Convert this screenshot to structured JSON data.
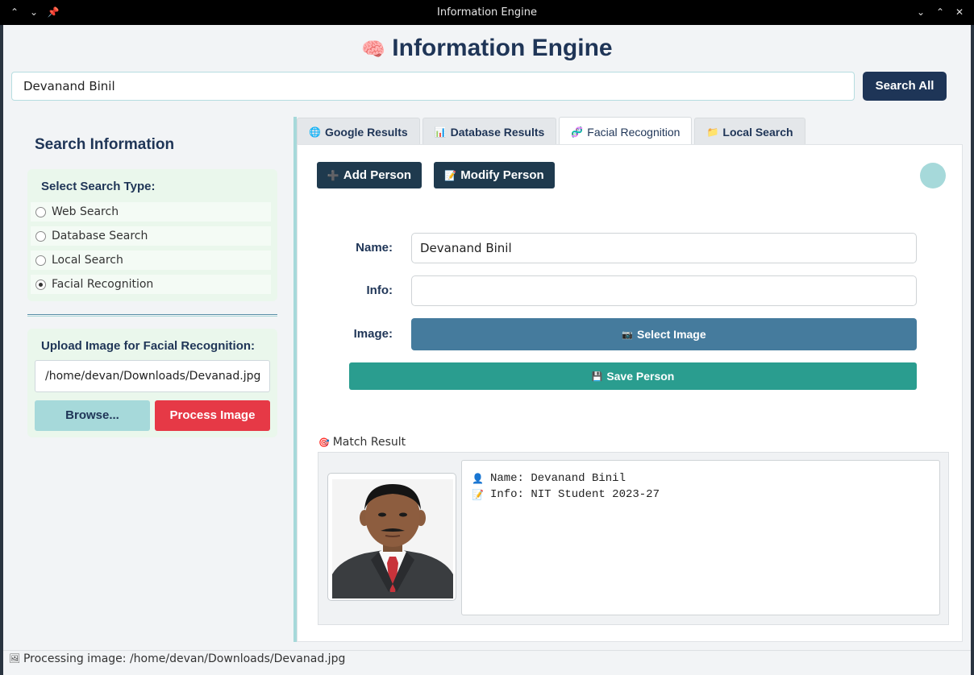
{
  "window": {
    "title": "Information Engine",
    "left_controls": [
      "⌃",
      "⌄",
      "📌"
    ],
    "right_controls": [
      "⌄",
      "⌃",
      "✕"
    ]
  },
  "header": {
    "icon": "🧠",
    "title": "Information Engine"
  },
  "search": {
    "value": "Devanand Binil",
    "button_label": "Search All"
  },
  "sidebar": {
    "title": "Search Information",
    "search_type_title": "Select Search Type:",
    "options": [
      {
        "label": "Web Search",
        "selected": false
      },
      {
        "label": "Database Search",
        "selected": false
      },
      {
        "label": "Local Search",
        "selected": false
      },
      {
        "label": "Facial Recognition",
        "selected": true
      }
    ],
    "upload_title": "Upload Image for Facial Recognition:",
    "upload_path": "/home/devan/Downloads/Devanad.jpg",
    "browse_label": "Browse...",
    "process_label": "Process Image"
  },
  "tabs": [
    {
      "icon": "🌐",
      "label": "Google Results",
      "active": false
    },
    {
      "icon": "📊",
      "label": "Database Results",
      "active": false
    },
    {
      "icon": "🧬",
      "label": "Facial Recognition",
      "active": true
    },
    {
      "icon": "📁",
      "label": "Local Search",
      "active": false
    }
  ],
  "facial": {
    "add_icon": "➕",
    "add_label": "Add Person",
    "modify_icon": "📝",
    "modify_label": "Modify Person",
    "name_label": "Name:",
    "name_value": "Devanand Binil",
    "info_label": "Info:",
    "info_value": "",
    "image_label": "Image:",
    "select_icon": "📷",
    "select_label": "Select Image",
    "save_icon": "💾",
    "save_label": "Save Person",
    "match_icon": "🎯",
    "match_label": "Match Result",
    "result": {
      "name_icon": "👤",
      "name_line": "Name: Devanand Binil",
      "info_icon": "📝",
      "info_line": "Info: NIT Student 2023-27"
    }
  },
  "status": {
    "icon": "🖼",
    "text": "Processing image: /home/devan/Downloads/Devanad.jpg"
  },
  "colors": {
    "title": "#1f3557",
    "search_button": "#1e3557",
    "process_button": "#e63946",
    "browse_button": "#a6d9da",
    "select_button": "#457b9d",
    "save_button": "#2a9d8f",
    "dark_button": "#1f3a4e"
  }
}
